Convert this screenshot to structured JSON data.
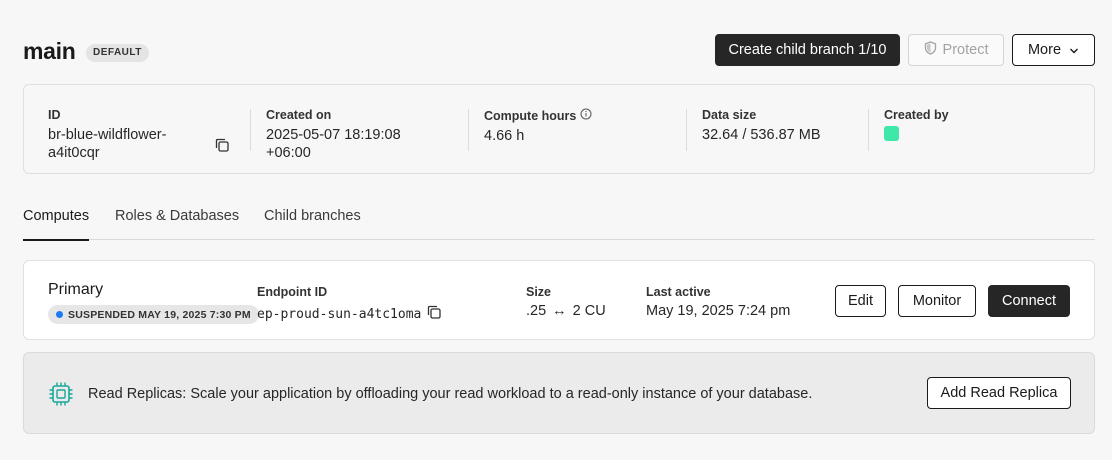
{
  "header": {
    "branch_name": "main",
    "default_badge": "DEFAULT",
    "create_child_label": "Create child branch 1/10",
    "protect_label": "Protect",
    "more_label": "More"
  },
  "info": {
    "id_label": "ID",
    "id_value_line1": "br-blue-wildflower-",
    "id_value_line2": "a4it0cqr",
    "created_on_label": "Created on",
    "created_on_line1": "2025-05-07 18:19:08",
    "created_on_line2": "+06:00",
    "compute_hours_label": "Compute hours",
    "compute_hours_value": "4.66 h",
    "data_size_label": "Data size",
    "data_size_value": "32.64 / 536.87 MB",
    "created_by_label": "Created by",
    "avatar_color": "#3ee8a8"
  },
  "tabs": [
    {
      "label": "Computes",
      "active": true
    },
    {
      "label": "Roles & Databases",
      "active": false
    },
    {
      "label": "Child branches",
      "active": false
    }
  ],
  "compute": {
    "name": "Primary",
    "status": "SUSPENDED MAY 19, 2025 7:30 PM",
    "status_color": "#1a7cf5",
    "endpoint_label": "Endpoint ID",
    "endpoint_value": "ep-proud-sun-a4tc1oma",
    "size_label": "Size",
    "size_min": ".25",
    "size_arrow": "↔",
    "size_max": "2 CU",
    "last_active_label": "Last active",
    "last_active_value": "May 19, 2025 7:24 pm",
    "edit_label": "Edit",
    "monitor_label": "Monitor",
    "connect_label": "Connect"
  },
  "replica": {
    "text": "Read Replicas: Scale your application by offloading your read workload to a read-only instance of your database.",
    "button_label": "Add Read Replica",
    "icon_color": "#1aa89a"
  }
}
